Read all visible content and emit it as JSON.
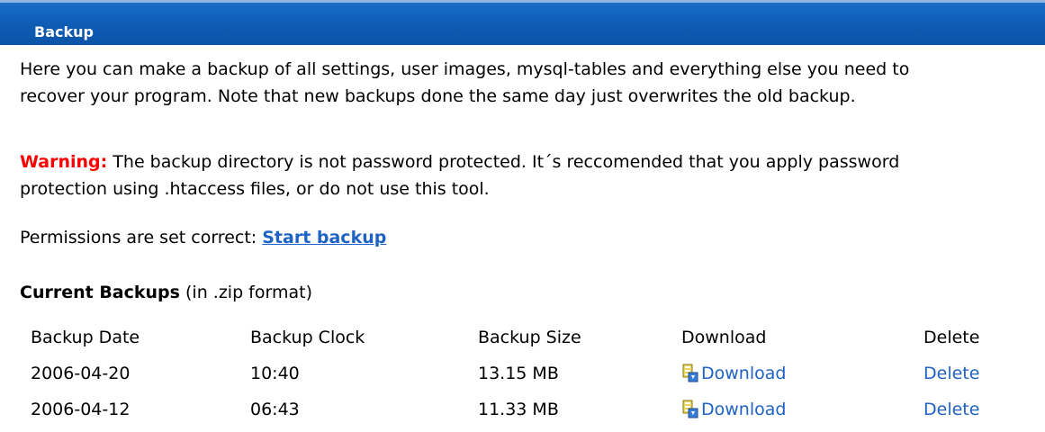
{
  "header": {
    "title": "Backup"
  },
  "intro": {
    "line1": "Here you can make a backup of all settings, user images, mysql-tables and everything else you need to",
    "line2": "recover your program. Note that new backups done the same day just overwrites the old backup."
  },
  "warning": {
    "label": "Warning:",
    "line1": " The backup directory is not password protected. It´s reccomended that you apply password",
    "line2": "protection using .htaccess files, or do not use this tool."
  },
  "permissions": {
    "text": "Permissions are set correct: ",
    "start_label": "Start backup"
  },
  "current_backups": {
    "title": "Current Backups",
    "subtitle": " (in .zip format)"
  },
  "table": {
    "headers": [
      "Backup Date",
      "Backup Clock",
      "Backup Size",
      "Download",
      "Delete"
    ],
    "rows": [
      {
        "date": "2006-04-20",
        "clock": "10:40",
        "size": "13.15 MB",
        "download": "Download",
        "delete": "Delete"
      },
      {
        "date": "2006-04-12",
        "clock": "06:43",
        "size": "11.33 MB",
        "download": "Download",
        "delete": "Delete"
      }
    ]
  },
  "icons": {
    "download": "download-package-icon"
  },
  "colors": {
    "header_bg": "#0f5cb5",
    "link": "#1d62c4",
    "warning": "#ff0000"
  }
}
